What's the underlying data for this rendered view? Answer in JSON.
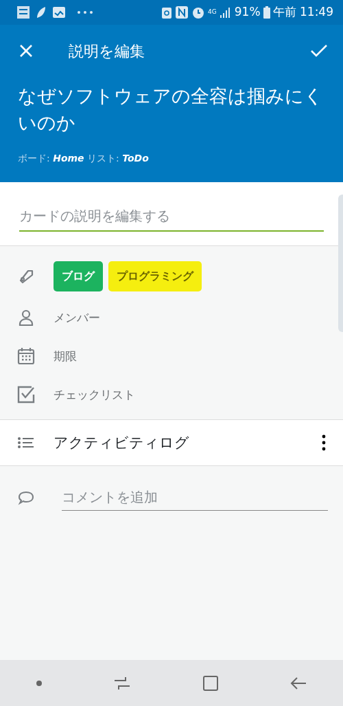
{
  "status_bar": {
    "network": "4G",
    "battery": "91%",
    "time": "午前 11:49"
  },
  "header": {
    "title": "説明を編集",
    "card_title": "なぜソフトウェアの全容は掴みにくいのか",
    "meta": "ボード: **Home** リスト: **ToDo**"
  },
  "description": {
    "placeholder": "カードの説明を編集する"
  },
  "labels": [
    {
      "text": "ブログ",
      "color": "#1cb35f"
    },
    {
      "text": "プログラミング",
      "color": "#f5ee0f"
    }
  ],
  "fields": [
    {
      "kind": "member",
      "text": "メンバー"
    },
    {
      "kind": "due",
      "text": "期限"
    },
    {
      "kind": "checklist",
      "text": "チェックリスト"
    }
  ],
  "activity": {
    "title": "アクティビティログ"
  },
  "comment": {
    "placeholder": "コメントを追加"
  }
}
